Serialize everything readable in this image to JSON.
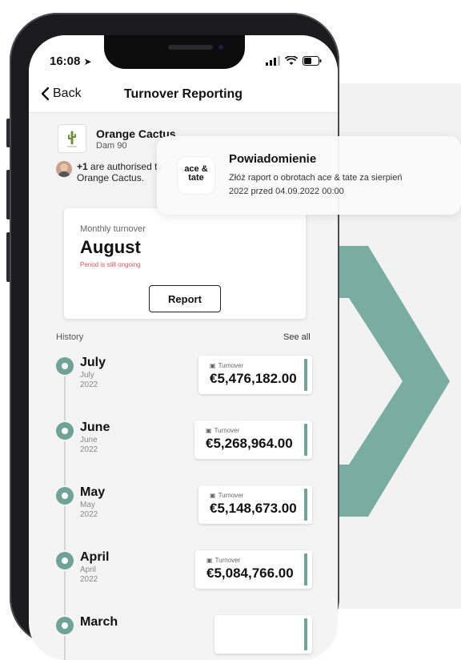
{
  "status": {
    "time": "16:08"
  },
  "nav": {
    "back_label": "Back",
    "title": "Turnover Reporting"
  },
  "store": {
    "name": "Orange Cactus",
    "address": "Dam 90",
    "auth_count": "+1",
    "auth_text": " are authorised to",
    "auth_text2": "Orange Cactus."
  },
  "current": {
    "subtitle": "Monthly turnover",
    "month": "August",
    "note": "Period is still ongoing",
    "report_button": "Report"
  },
  "history": {
    "label": "History",
    "see_all": "See all",
    "items": [
      {
        "month": "July",
        "sub_month": "July",
        "year": "2022",
        "card_label": "Turnover",
        "amount": "€5,476,182.00"
      },
      {
        "month": "June",
        "sub_month": "June",
        "year": "2022",
        "card_label": "Turnover",
        "amount": "€5,268,964.00"
      },
      {
        "month": "May",
        "sub_month": "May",
        "year": "2022",
        "card_label": "Turnover",
        "amount": "€5,148,673.00"
      },
      {
        "month": "April",
        "sub_month": "April",
        "year": "2022",
        "card_label": "Turnover",
        "amount": "€5,084,766.00"
      },
      {
        "month": "March",
        "sub_month": "",
        "year": "",
        "card_label": "",
        "amount": ""
      }
    ]
  },
  "notification": {
    "title": "Powiadomienie",
    "body": "Złóż raport o obrotach ace & tate za sierpień 2022 przed 04.09.2022 00:00",
    "app_logo_line1": "ace &",
    "app_logo_line2": "tate"
  },
  "colors": {
    "accent": "#6fa398",
    "warning": "#d0585f",
    "background_shape": "#7aada1"
  }
}
